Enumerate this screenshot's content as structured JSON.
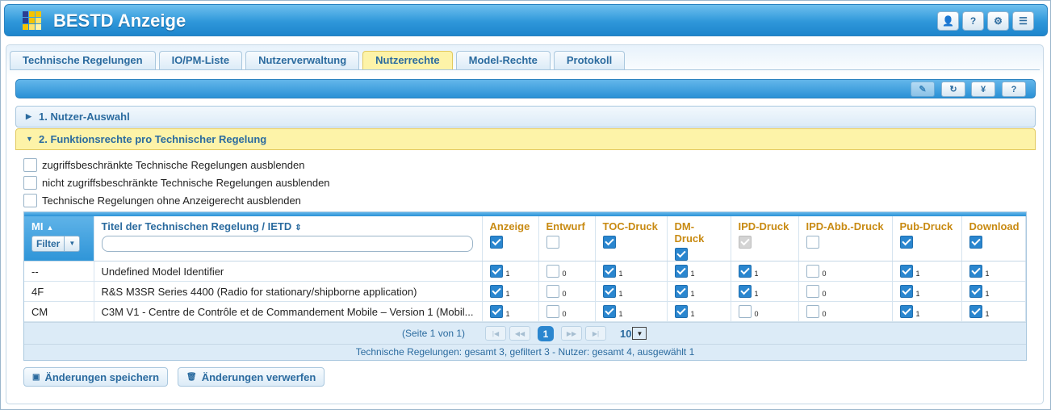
{
  "app": {
    "title": "BESTD Anzeige",
    "header_buttons": [
      {
        "name": "user-icon",
        "glyph": "👤"
      },
      {
        "name": "help-icon",
        "glyph": "?"
      },
      {
        "name": "gear-icon",
        "glyph": "⚙"
      },
      {
        "name": "menu-icon",
        "glyph": "☰"
      }
    ]
  },
  "tabs": [
    {
      "label": "Technische Regelungen",
      "active": false
    },
    {
      "label": "IO/PM-Liste",
      "active": false
    },
    {
      "label": "Nutzerverwaltung",
      "active": false
    },
    {
      "label": "Nutzerrechte",
      "active": true
    },
    {
      "label": "Model-Rechte",
      "active": false
    },
    {
      "label": "Protokoll",
      "active": false
    }
  ],
  "toolbar": {
    "buttons": [
      {
        "name": "edit-icon",
        "glyph": "✎",
        "disabled": true
      },
      {
        "name": "refresh-icon",
        "glyph": "↻",
        "disabled": false
      },
      {
        "name": "yen-icon",
        "glyph": "¥",
        "disabled": false
      },
      {
        "name": "help-icon",
        "glyph": "?",
        "disabled": false
      }
    ]
  },
  "sections": {
    "user_selection": "1. Nutzer-Auswahl",
    "function_rights": "2. Funktionsrechte pro Technischer Regelung"
  },
  "options": [
    {
      "label": "zugriffsbeschränkte Technische Regelungen ausblenden",
      "checked": false
    },
    {
      "label": "nicht zugriffsbeschränkte Technische Regelungen ausblenden",
      "checked": false
    },
    {
      "label": "Technische Regelungen ohne Anzeigerecht ausblenden",
      "checked": false
    }
  ],
  "grid": {
    "col_mi": "MI",
    "filter_label": "Filter",
    "col_title": "Titel der Technischen Regelung / IETD",
    "right_columns": [
      "Anzeige",
      "Entwurf",
      "TOC-Druck",
      "DM-Druck",
      "IPD-Druck",
      "IPD-Abb.-Druck",
      "Pub-Druck",
      "Download"
    ],
    "header_checks": [
      "on",
      "off",
      "on",
      "on",
      "dis",
      "off",
      "on",
      "on"
    ],
    "rows": [
      {
        "mi": "--",
        "title": "Undefined Model Identifier",
        "rights": [
          1,
          0,
          1,
          1,
          1,
          0,
          1,
          1
        ]
      },
      {
        "mi": "4F",
        "title": "R&S M3SR Series 4400 (Radio for stationary/shipborne application)",
        "rights": [
          1,
          0,
          1,
          1,
          1,
          0,
          1,
          1
        ]
      },
      {
        "mi": "CM",
        "title": "C3M V1 - Centre de Contrôle et de Commandement Mobile – Version 1 (Mobil...",
        "rights": [
          1,
          0,
          1,
          1,
          0,
          0,
          1,
          1
        ]
      }
    ],
    "pager": {
      "info": "(Seite 1 von 1)",
      "current_page": "1",
      "page_size": "10"
    },
    "status": "Technische Regelungen: gesamt 3, gefiltert 3 - Nutzer: gesamt 4, ausgewählt 1"
  },
  "actions": {
    "save_label": "Änderungen speichern",
    "discard_label": "Änderungen verwerfen"
  },
  "colors": {
    "accent": "#2f97da",
    "active_tab": "#fdf3a8",
    "header_text": "#c88a12"
  }
}
